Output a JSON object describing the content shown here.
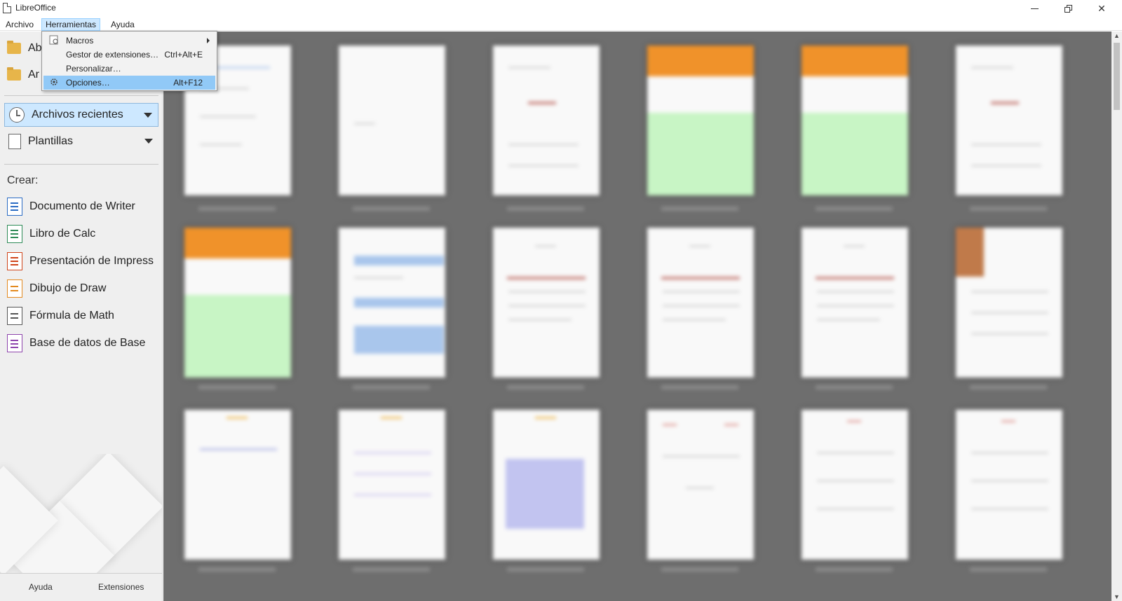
{
  "window": {
    "title": "LibreOffice"
  },
  "menubar": {
    "items": [
      "Archivo",
      "Herramientas",
      "Ayuda"
    ],
    "active": "Herramientas"
  },
  "dropdown": {
    "items": [
      {
        "label": "Macros",
        "accel": "",
        "submenu": true,
        "icon": "macros-icon"
      },
      {
        "label": "Gestor de extensiones…",
        "accel": "Ctrl+Alt+E",
        "submenu": false,
        "icon": ""
      },
      {
        "label": "Personalizar…",
        "accel": "",
        "submenu": false,
        "icon": ""
      },
      {
        "label": "Opciones…",
        "accel": "Alt+F12",
        "submenu": false,
        "icon": "gear-icon",
        "highlighted": true
      }
    ]
  },
  "sidebar": {
    "open_items": [
      "Ab",
      "Ar"
    ],
    "recent_label": "Archivos recientes",
    "templates_label": "Plantillas",
    "create_label": "Crear:",
    "create_items": [
      {
        "label": "Documento de Writer",
        "color": "#2b6cc4"
      },
      {
        "label": "Libro de Calc",
        "color": "#2e8b57"
      },
      {
        "label": "Presentación de Impress",
        "color": "#d0451b"
      },
      {
        "label": "Dibujo de Draw",
        "color": "#e38a1f"
      },
      {
        "label": "Fórmula de Math",
        "color": "#555555"
      },
      {
        "label": "Base de datos de Base",
        "color": "#8e44ad"
      }
    ],
    "footer": {
      "help": "Ayuda",
      "extensions": "Extensiones"
    }
  },
  "colors": {
    "accent": "#cde8ff",
    "highlight": "#91c9f7",
    "main_bg": "#6e6e6e"
  }
}
